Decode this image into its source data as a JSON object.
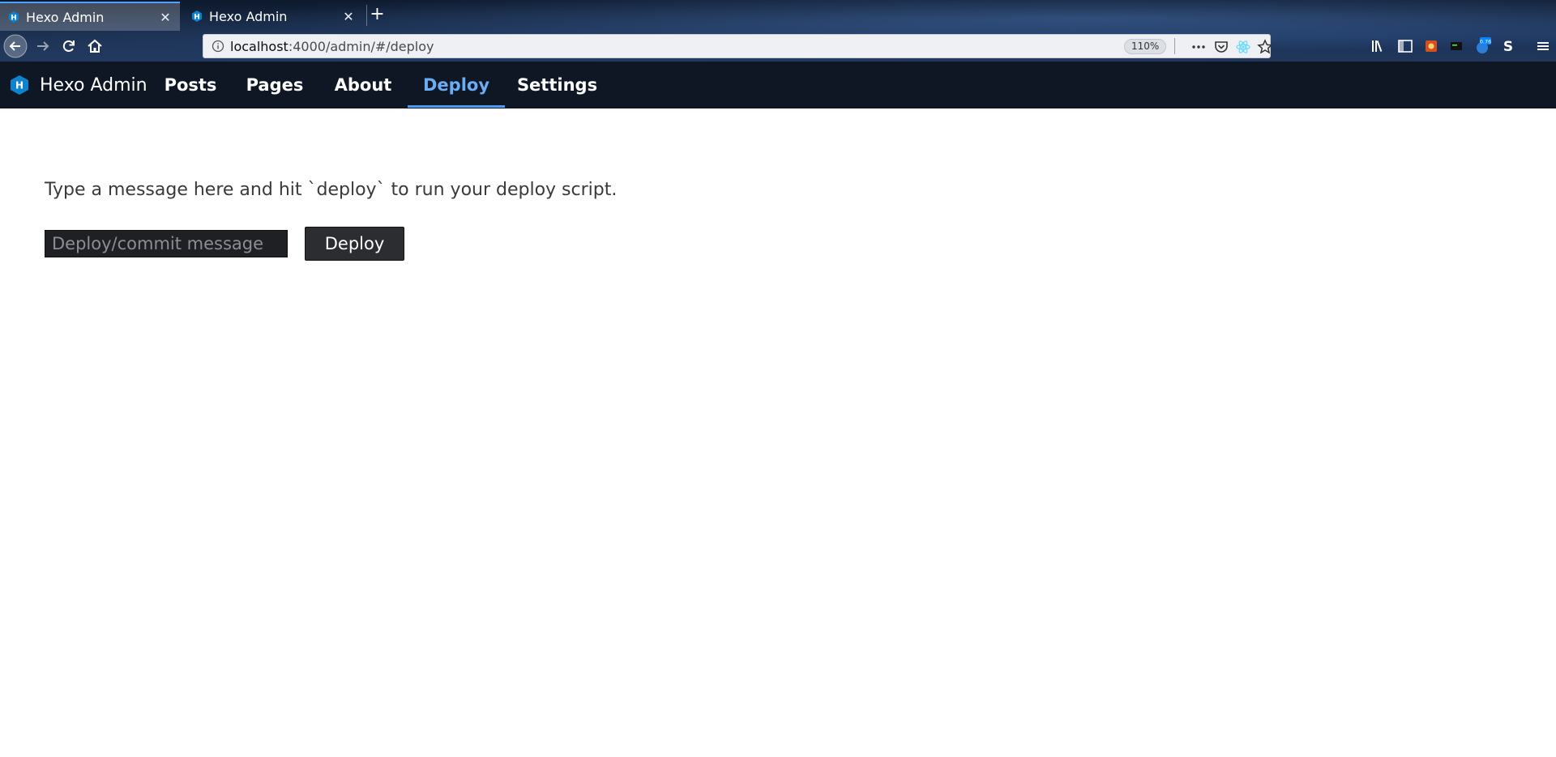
{
  "browser": {
    "tabs": [
      {
        "title": "Hexo Admin",
        "active": true
      },
      {
        "title": "Hexo Admin",
        "active": false
      }
    ],
    "new_tab_label": "+",
    "url": {
      "host": "localhost",
      "path": ":4000/admin/#/deploy"
    },
    "zoom": "110%",
    "toolbar_badge": "0.76"
  },
  "app": {
    "brand": "Hexo Admin",
    "nav": [
      {
        "label": "Posts",
        "active": false
      },
      {
        "label": "Pages",
        "active": false
      },
      {
        "label": "About",
        "active": false
      },
      {
        "label": "Deploy",
        "active": true
      },
      {
        "label": "Settings",
        "active": false
      }
    ]
  },
  "deploy": {
    "instructions": "Type a message here and hit `deploy` to run your deploy script.",
    "input_value": "",
    "input_placeholder": "Deploy/commit message",
    "button_label": "Deploy"
  },
  "colors": {
    "header_bg": "#0f1725",
    "accent": "#4a9cf0",
    "button_bg": "#2b2d30"
  }
}
